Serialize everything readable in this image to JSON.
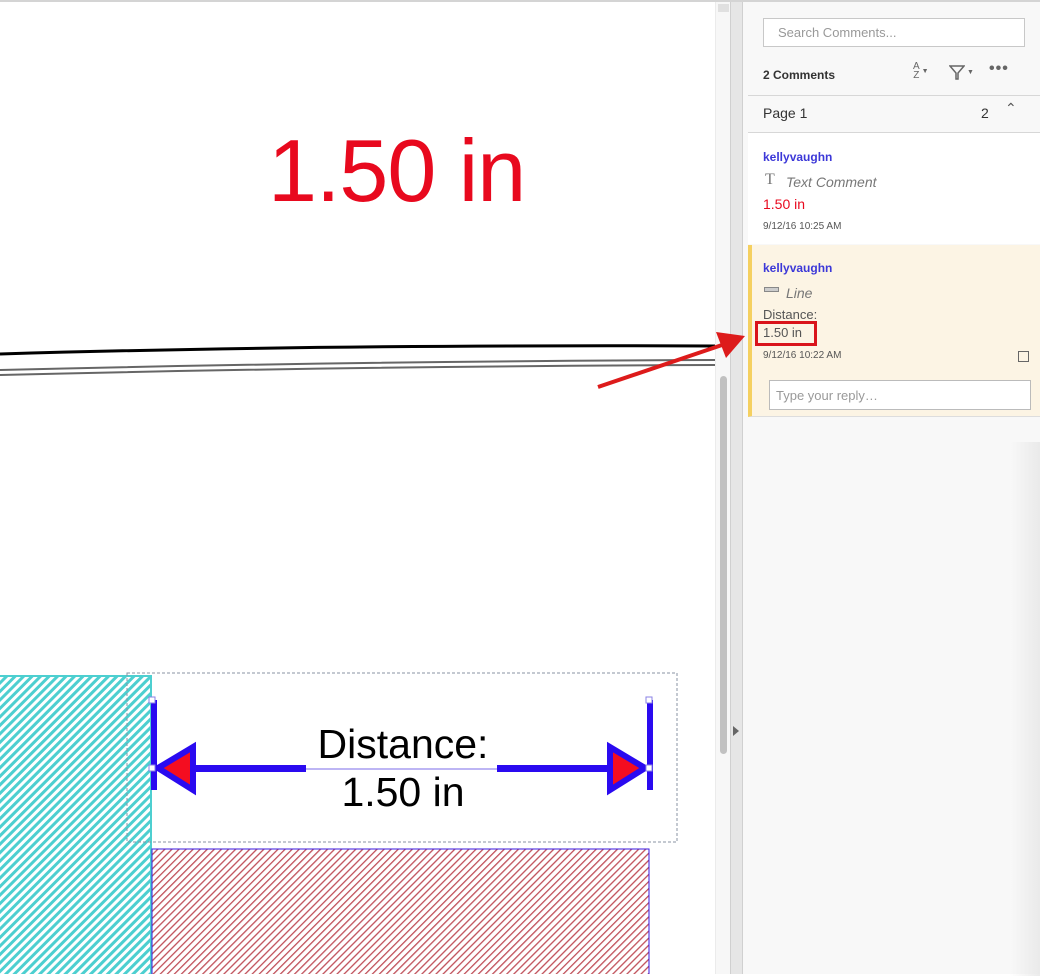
{
  "document": {
    "big_label": "1.50 in",
    "measurement": {
      "line1": "Distance:",
      "line2": "1.50 in"
    },
    "colors": {
      "big_label": "#e8091e",
      "arrow_stroke": "#2a0af0",
      "arrow_fill": "#f40d20",
      "hatch_left": "#4dcfd0",
      "hatch_right": "#c0505a",
      "callout_arrow": "#dd1b1b"
    }
  },
  "comments_panel": {
    "search_placeholder": "Search Comments...",
    "count_label": "2 Comments",
    "toolbar": {
      "sort_icon": "sort-az-icon",
      "filter_icon": "filter-icon",
      "more_icon": "more-icon"
    },
    "page_group": {
      "label": "Page 1",
      "count": "2"
    },
    "comments": [
      {
        "author": "kellyvaughn",
        "type": "Text Comment",
        "type_icon": "text-tool-icon",
        "body": "1.50 in",
        "timestamp": "9/12/16  10:25 AM"
      },
      {
        "author": "kellyvaughn",
        "type": "Line",
        "type_icon": "line-tool-icon",
        "body_label": "Distance:",
        "body_value": "1.50 in",
        "timestamp": "9/12/16  10:22 AM",
        "reply_placeholder": "Type your reply…"
      }
    ]
  }
}
